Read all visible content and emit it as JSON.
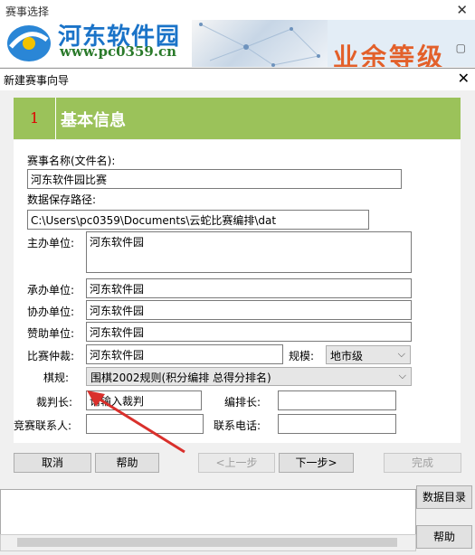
{
  "parent_window": {
    "title": "赛事选择",
    "close_glyph": "✕",
    "restore_glyph": "▢",
    "banner_text": "业余等级",
    "watermark_name": "河东软件园",
    "watermark_url": "www.pc0359.cn"
  },
  "dialog": {
    "title": "新建赛事向导",
    "close_glyph": "✕"
  },
  "step": {
    "number": "1",
    "title": "基本信息"
  },
  "form": {
    "event_name_label": "赛事名称(文件名):",
    "event_name_value": "河东软件园比赛",
    "save_path_label": "数据保存路径:",
    "save_path_value": "C:\\Users\\pc0359\\Documents\\云蛇比赛编排\\dat",
    "host_label": "主办单位:",
    "host_value": "河东软件园",
    "organizer_label": "承办单位:",
    "organizer_value": "河东软件园",
    "co_organizer_label": "协办单位:",
    "co_organizer_value": "河东软件园",
    "sponsor_label": "赞助单位:",
    "sponsor_value": "河东软件园",
    "arbitration_label": "比赛仲裁:",
    "arbitration_value": "河东软件园",
    "scale_label": "规模:",
    "scale_value": "地市级",
    "rules_label": "棋规:",
    "rules_value": "围棋2002规则(积分编排 总得分排名)",
    "chief_referee_label": "裁判长:",
    "chief_referee_value": "请输入裁判",
    "chief_arranger_label": "编排长:",
    "chief_arranger_value": "",
    "contact_label": "竞赛联系人:",
    "contact_value": "",
    "phone_label": "联系电话:",
    "phone_value": ""
  },
  "buttons": {
    "cancel": "取消",
    "help": "帮助",
    "prev": "<上一步",
    "next": "下一步>",
    "finish": "完成"
  },
  "parent_bottom": {
    "data_dir_button": "数据目录",
    "help_button": "帮助"
  },
  "colors": {
    "step_header_bg": "#9bc25a",
    "step_number": "#e00000",
    "annotation_arrow": "#d9302c"
  }
}
